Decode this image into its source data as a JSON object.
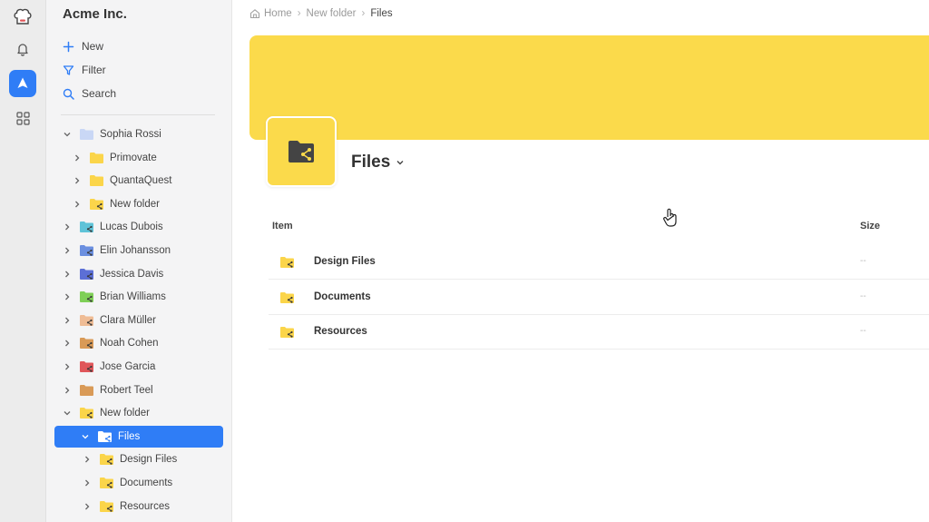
{
  "sidebar": {
    "org_name": "Acme Inc.",
    "actions": [
      {
        "label": "New",
        "icon": "plus-icon"
      },
      {
        "label": "Filter",
        "icon": "filter-icon"
      },
      {
        "label": "Search",
        "icon": "search-icon"
      }
    ],
    "tree": [
      {
        "label": "Sophia Rossi",
        "expanded": true,
        "color": "#c9d7f5",
        "shared": false
      },
      {
        "label": "Primovate",
        "expanded": false,
        "color": "#fbd54a",
        "shared": false
      },
      {
        "label": "QuantaQuest",
        "expanded": false,
        "color": "#fbd54a",
        "shared": false
      },
      {
        "label": "New folder",
        "expanded": false,
        "color": "#fbd54a",
        "shared": true
      },
      {
        "label": "Lucas Dubois",
        "expanded": false,
        "color": "#5fc3d8",
        "shared": true
      },
      {
        "label": "Elin Johansson",
        "expanded": false,
        "color": "#6b8fe0",
        "shared": true
      },
      {
        "label": "Jessica Davis",
        "expanded": false,
        "color": "#5c6fd6",
        "shared": true
      },
      {
        "label": "Brian Williams",
        "expanded": false,
        "color": "#7fcf57",
        "shared": true
      },
      {
        "label": "Clara Müller",
        "expanded": false,
        "color": "#efbc95",
        "shared": true
      },
      {
        "label": "Noah Cohen",
        "expanded": false,
        "color": "#d99a57",
        "shared": true
      },
      {
        "label": "Jose Garcia",
        "expanded": false,
        "color": "#e0565a",
        "shared": true
      },
      {
        "label": "Robert Teel",
        "expanded": false,
        "color": "#d99a57",
        "shared": false
      },
      {
        "label": "New folder",
        "expanded": true,
        "color": "#fbd54a",
        "shared": true
      },
      {
        "label": "Files",
        "expanded": true,
        "color": "#ffffff",
        "shared": true,
        "selected": true
      },
      {
        "label": "Design Files",
        "expanded": false,
        "color": "#fbd54a",
        "shared": true
      },
      {
        "label": "Documents",
        "expanded": false,
        "color": "#fbd54a",
        "shared": true
      },
      {
        "label": "Resources",
        "expanded": false,
        "color": "#fbd54a",
        "shared": true
      }
    ]
  },
  "breadcrumb": {
    "items": [
      "Home",
      "New folder",
      "Files"
    ]
  },
  "header": {
    "title": "Files",
    "banner_color": "#fbda4b"
  },
  "table": {
    "columns": {
      "item": "Item",
      "size": "Size"
    },
    "rows": [
      {
        "name": "Design Files",
        "size": "--"
      },
      {
        "name": "Documents",
        "size": "--"
      },
      {
        "name": "Resources",
        "size": "--"
      }
    ]
  },
  "colors": {
    "accent": "#2f7df6",
    "folder_yellow": "#fbd54a"
  }
}
